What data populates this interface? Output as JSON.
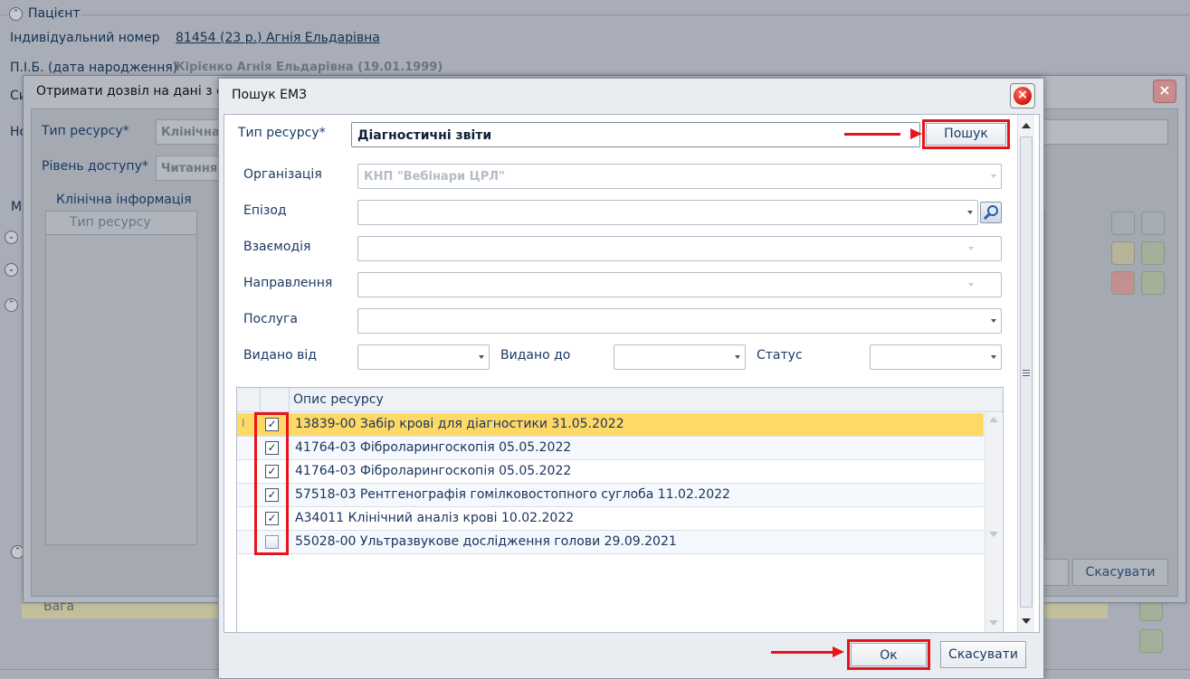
{
  "patient": {
    "section_title": "Пацієнт",
    "id_label": "Індивідуальний номер",
    "id_value": "81454 (23 р.) Агнія Ельдарівна",
    "name_label": "П.І.Б. (дата народження)",
    "name_value": "Кірієнко Агнія Ельдарівна (19.01.1999)",
    "row3_label": "Си",
    "row4_label": "Но",
    "tab_label": "М",
    "bottom_row_label": "Вага"
  },
  "permission_dialog": {
    "title": "Отримати дозвіл на дані з сис",
    "resource_type_label": "Тип ресурсу*",
    "resource_type_value": "Клінічна",
    "access_level_label": "Рівень доступу*",
    "access_level_value": "Читання",
    "clinical_info_legend": "Клінічна інформація",
    "grid_column": "Тип ресурсу",
    "cancel_label": "Скасувати"
  },
  "search_dialog": {
    "title": "Пошук ЕМЗ",
    "close_icon": "close-icon",
    "resource_type_label": "Тип ресурсу*",
    "resource_type_value": "Діагностичні звіти",
    "search_button": "Пошук",
    "organization_label": "Організація",
    "organization_value": "КНП \"Вебінари ЦРЛ\"",
    "episode_label": "Епізод",
    "interaction_label": "Взаємодія",
    "referral_label": "Направлення",
    "service_label": "Послуга",
    "issued_from_label": "Видано від",
    "issued_to_label": "Видано до",
    "status_label": "Статус",
    "grid": {
      "column": "Опис ресурсу",
      "rows": [
        {
          "text": "13839-00 Забір крові для діагностики 31.05.2022",
          "checked": true,
          "selected": true
        },
        {
          "text": "41764-03 Фіброларингоскопія 05.05.2022",
          "checked": true,
          "selected": false
        },
        {
          "text": "41764-03 Фіброларингоскопія 05.05.2022",
          "checked": true,
          "selected": false
        },
        {
          "text": "57518-03 Рентгенографія гомілковостопного суглоба 11.02.2022",
          "checked": true,
          "selected": false
        },
        {
          "text": "А34011 Клінічний аналіз крові 10.02.2022",
          "checked": true,
          "selected": false
        },
        {
          "text": "55028-00 Ультразвукове дослідження голови 29.09.2021",
          "checked": false,
          "selected": false
        }
      ]
    },
    "ok_button": "Ок",
    "cancel_button": "Скасувати"
  },
  "colors": {
    "highlight": "#e8141b",
    "selected_row": "#ffd966",
    "text": "#1b3a63"
  }
}
